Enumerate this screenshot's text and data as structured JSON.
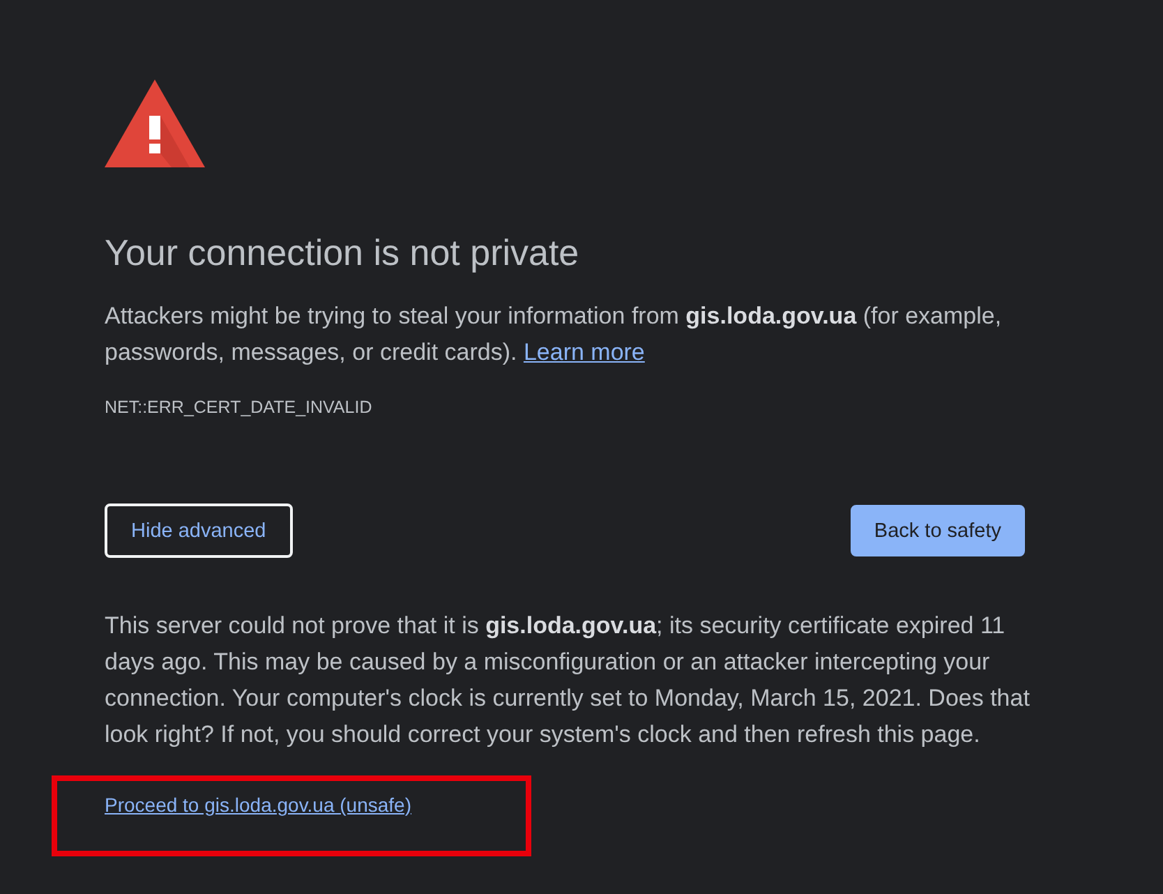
{
  "heading": "Your connection is not private",
  "message": "Attackers might be trying to steal your information from **gis.loda.gov.ua** (for example, passwords, messages, or credit cards).",
  "learn_more_link": "Learn more",
  "error_code": "NET::ERR_CERT_DATE_INVALID",
  "buttons": [
    {
      "label": "Hide advanced",
      "kind": "secondary"
    },
    {
      "label": "Back to safety",
      "kind": "primary"
    }
  ],
  "details": "This server could not prove that it is **gis.loda.gov.ua**; its security certificate expired 11 days ago. This may be caused by a misconfiguration or an attacker intercepting your connection. Your computer's clock is currently set to Monday, March 15, 2021. Does that look right? If not, you should correct your system's clock and then refresh this page.",
  "proceed_link": {
    "label": "Proceed to gis.loda.gov.ua (unsafe)",
    "highlighted": true
  }
}
